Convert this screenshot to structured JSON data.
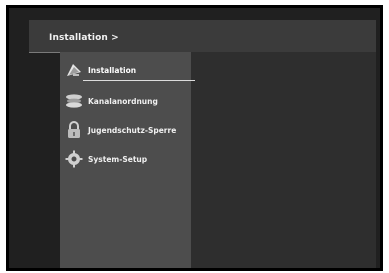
{
  "header": {
    "breadcrumb": "Installation >"
  },
  "menu": {
    "items": [
      {
        "label": "Installation",
        "icon": "satellite-dish-icon",
        "selected": true
      },
      {
        "label": "Kanalanordnung",
        "icon": "channel-list-icon",
        "selected": false
      },
      {
        "label": "Jugendschutz-Sperre",
        "icon": "lock-icon",
        "selected": false
      },
      {
        "label": "System-Setup",
        "icon": "gear-icon",
        "selected": false
      }
    ]
  }
}
